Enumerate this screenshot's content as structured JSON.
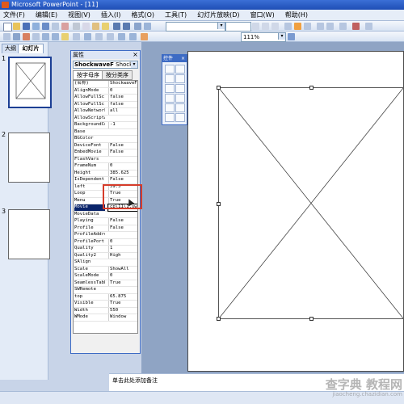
{
  "window": {
    "title": "Microsoft PowerPoint - [11]"
  },
  "menu": [
    "文件(F)",
    "编辑(E)",
    "视图(V)",
    "插入(I)",
    "格式(O)",
    "工具(T)",
    "幻灯片放映(D)",
    "窗口(W)",
    "帮助(H)"
  ],
  "toolbar": {
    "zoom": "111%",
    "font_combo_arrow": "▾"
  },
  "left_panel": {
    "tabs": [
      "大纲",
      "幻灯片"
    ],
    "slides": [
      "1",
      "2",
      "3"
    ]
  },
  "properties": {
    "title": "属性",
    "close": "×",
    "object_bold": "ShockwaveF",
    "object_rest": " ShockwaveF",
    "object_arrow": "▾",
    "tabs": [
      "按字母序",
      "按分类序"
    ],
    "rows": [
      {
        "name": "(名称)",
        "value": "ShockwaveFl"
      },
      {
        "name": "AlignMode",
        "value": "0"
      },
      {
        "name": "AllowFullScr",
        "value": "false"
      },
      {
        "name": "AllowFullScr",
        "value": "false"
      },
      {
        "name": "AllowNetwork",
        "value": "all"
      },
      {
        "name": "AllowScriptA",
        "value": ""
      },
      {
        "name": "BackgroundCol",
        "value": "-1"
      },
      {
        "name": "Base",
        "value": ""
      },
      {
        "name": "BGColor",
        "value": ""
      },
      {
        "name": "DeviceFont",
        "value": "False"
      },
      {
        "name": "EmbedMovie",
        "value": "False"
      },
      {
        "name": "FlashVars",
        "value": ""
      },
      {
        "name": "FrameNum",
        "value": "0"
      },
      {
        "name": "Height",
        "value": "385.625"
      },
      {
        "name": "IsDependent",
        "value": "False"
      },
      {
        "name": "left",
        "value": "59.5"
      },
      {
        "name": "Loop",
        "value": "True"
      },
      {
        "name": "Menu",
        "value": "True"
      },
      {
        "name": "Movie",
        "value": "cp\\11\\1.swf"
      },
      {
        "name": "MovieData",
        "value": ""
      },
      {
        "name": "Playing",
        "value": "False"
      },
      {
        "name": "Profile",
        "value": "False"
      },
      {
        "name": "ProfileAddre",
        "value": ""
      },
      {
        "name": "ProfilePort",
        "value": "0"
      },
      {
        "name": "Quality",
        "value": "1"
      },
      {
        "name": "Quality2",
        "value": "High"
      },
      {
        "name": "SAlign",
        "value": ""
      },
      {
        "name": "Scale",
        "value": "ShowAll"
      },
      {
        "name": "ScaleMode",
        "value": "0"
      },
      {
        "name": "SeamlessTabb",
        "value": "True"
      },
      {
        "name": "SWRemote",
        "value": ""
      },
      {
        "name": "top",
        "value": "65.875"
      },
      {
        "name": "Visible",
        "value": "True"
      },
      {
        "name": "Width",
        "value": "550"
      },
      {
        "name": "WMode",
        "value": "Window"
      }
    ]
  },
  "toolbox": {
    "title": "控件",
    "close": "×"
  },
  "notes": {
    "placeholder": "单击此处添加备注"
  },
  "watermark": {
    "line1": "查字典 教程网",
    "line2": "jiaocheng.chazidian.com"
  }
}
